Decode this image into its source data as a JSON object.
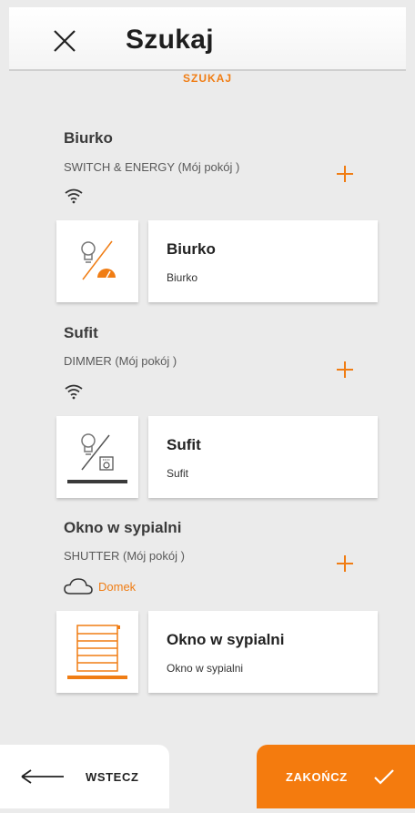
{
  "header": {
    "title": "Szukaj",
    "close_icon": "close-icon"
  },
  "section_label": "SZUKAJ",
  "groups": [
    {
      "title": "Biurko",
      "subtitle": "SWITCH & ENERGY (Mój pokój )",
      "connection_icon": "wifi-icon",
      "card": {
        "title": "Biurko",
        "subtitle": "Biurko",
        "icon": "switch-energy-icon"
      }
    },
    {
      "title": "Sufit",
      "subtitle": "DIMMER (Mój pokój )",
      "connection_icon": "wifi-icon",
      "card": {
        "title": "Sufit",
        "subtitle": "Sufit",
        "icon": "dimmer-icon"
      }
    },
    {
      "title": "Okno w sypialni",
      "subtitle": "SHUTTER (Mój pokój )",
      "connection_icon": "cloud-icon",
      "cloud_label": "Domek",
      "card": {
        "title": "Okno w sypialni",
        "subtitle": "Okno w sypialni",
        "icon": "shutter-icon"
      }
    }
  ],
  "footer": {
    "back_label": "WSTECZ",
    "finish_label": "ZAKOŃCZ"
  },
  "colors": {
    "accent": "#f47b0e",
    "background": "#ebebeb",
    "card": "#ffffff",
    "text": "#3a3a3a"
  }
}
